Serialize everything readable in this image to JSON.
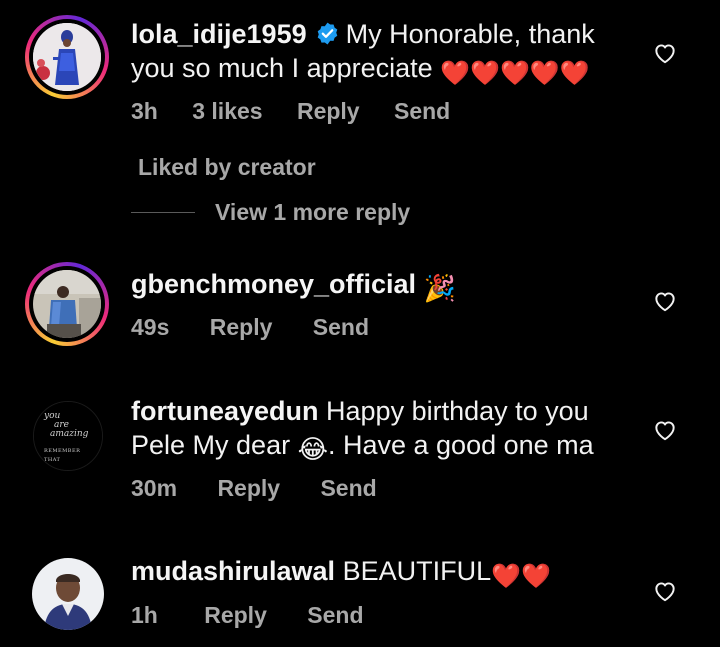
{
  "comments": [
    {
      "username": "lola_idije1959",
      "verified": true,
      "text_line1": "My Honorable, thank",
      "text_line2": "you so much I appreciate",
      "hearts": "❤️❤️❤️❤️❤️",
      "time": "3h",
      "likes": "3 likes",
      "reply_label": "Reply",
      "send_label": "Send",
      "liked_by": "Liked by creator",
      "view_more": "View 1 more reply"
    },
    {
      "username": "gbenchmoney_official",
      "emoji": "🎉",
      "time": "49s",
      "reply_label": "Reply",
      "send_label": "Send"
    },
    {
      "username": "fortuneayedun",
      "text_line1": "Happy birthday to you",
      "text_line2_a": "Pele My dear",
      "emoji": "😂",
      "text_line2_b": ". Have a good one ma",
      "time": "30m",
      "reply_label": "Reply",
      "send_label": "Send",
      "avatar_text_1": "you",
      "avatar_text_2": "are",
      "avatar_text_3": "amazing",
      "avatar_text_4": "REMEMBER THAT"
    },
    {
      "username": "mudashirulawal",
      "text": "BEAUTIFUL",
      "hearts": "❤️❤️",
      "time": "1h",
      "reply_label": "Reply",
      "send_label": "Send"
    }
  ],
  "colors": {
    "background": "#000000",
    "text": "#f2f2f2",
    "meta": "#a8a8a8",
    "verified": "#1d9bf0",
    "heart": "#e8263b"
  },
  "icons": {
    "like": "heart-outline-icon",
    "verified": "verified-badge-icon"
  }
}
